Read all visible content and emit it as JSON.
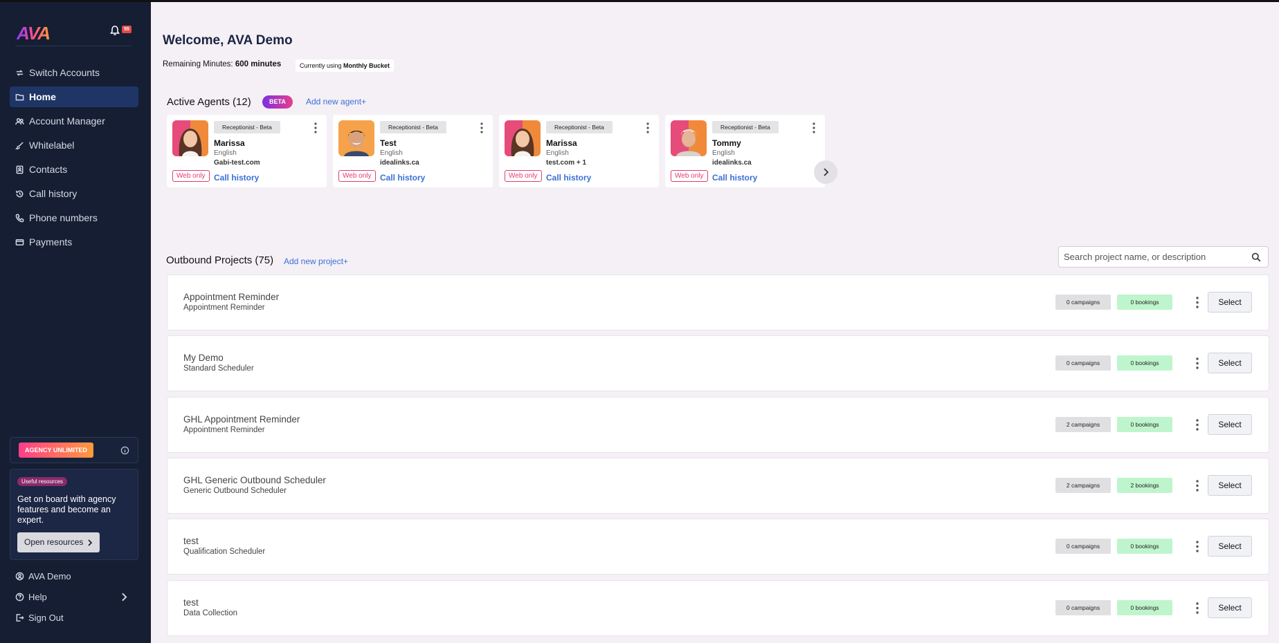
{
  "app": {
    "logo": "AVA",
    "notifications_count": "55"
  },
  "sidebar": {
    "items": [
      {
        "label": "Switch Accounts",
        "icon": "switch-icon"
      },
      {
        "label": "Home",
        "icon": "folder-icon"
      },
      {
        "label": "Account Manager",
        "icon": "users-icon"
      },
      {
        "label": "Whitelabel",
        "icon": "brush-icon"
      },
      {
        "label": "Contacts",
        "icon": "contacts-icon"
      },
      {
        "label": "Call history",
        "icon": "history-icon"
      },
      {
        "label": "Phone numbers",
        "icon": "phone-icon"
      },
      {
        "label": "Payments",
        "icon": "card-icon"
      }
    ],
    "agency_badge": "AGENCY UNLIMITED",
    "resources": {
      "badge": "Useful resources",
      "text": "Get on board with agency features and become an expert.",
      "button": "Open resources"
    },
    "bottom": {
      "user": "AVA Demo",
      "help": "Help",
      "sign_out": "Sign Out"
    }
  },
  "header": {
    "welcome": "Welcome, AVA Demo",
    "remaining_label": "Remaining Minutes: ",
    "remaining_value": "600 minutes",
    "bucket_label": "Currently using ",
    "bucket_value": "Monthly Bucket"
  },
  "agents": {
    "title": "Active Agents (12)",
    "beta": "BETA",
    "add": "Add new agent+",
    "cards": [
      {
        "role": "Receptionist - Beta",
        "name": "Marissa",
        "language": "English",
        "site": "Gabi-test.com",
        "web_only": "Web only",
        "history": "Call history"
      },
      {
        "role": "Receptionist - Beta",
        "name": "Test",
        "language": "English",
        "site": "idealinks.ca",
        "web_only": "Web only",
        "history": "Call history"
      },
      {
        "role": "Receptionist - Beta",
        "name": "Marissa",
        "language": "English",
        "site": "test.com + 1",
        "web_only": "Web only",
        "history": "Call history"
      },
      {
        "role": "Receptionist - Beta",
        "name": "Tommy",
        "language": "English",
        "site": "idealinks.ca",
        "web_only": "Web only",
        "history": "Call history"
      }
    ]
  },
  "projects": {
    "title": "Outbound Projects (75)",
    "add": "Add new project+",
    "search_placeholder": "Search project name, or description",
    "select_label": "Select",
    "rows": [
      {
        "name": "Appointment Reminder",
        "type": "Appointment Reminder",
        "campaigns": "0 campaigns",
        "bookings": "0 bookings"
      },
      {
        "name": "My Demo",
        "type": "Standard Scheduler",
        "campaigns": "0 campaigns",
        "bookings": "0 bookings"
      },
      {
        "name": "GHL Appointment Reminder",
        "type": "Appointment Reminder",
        "campaigns": "2 campaigns",
        "bookings": "0 bookings"
      },
      {
        "name": "GHL Generic Outbound Scheduler",
        "type": "Generic Outbound Scheduler",
        "campaigns": "2 campaigns",
        "bookings": "2 bookings"
      },
      {
        "name": "test",
        "type": "Qualification Scheduler",
        "campaigns": "0 campaigns",
        "bookings": "0 bookings"
      },
      {
        "name": "test",
        "type": "Data Collection",
        "campaigns": "0 campaigns",
        "bookings": "0 bookings"
      }
    ]
  },
  "colors": {
    "sidebar_bg": "#151e33",
    "active_nav": "#1f3566",
    "link": "#3b6fd6",
    "bookings_badge": "#bff5cd"
  }
}
